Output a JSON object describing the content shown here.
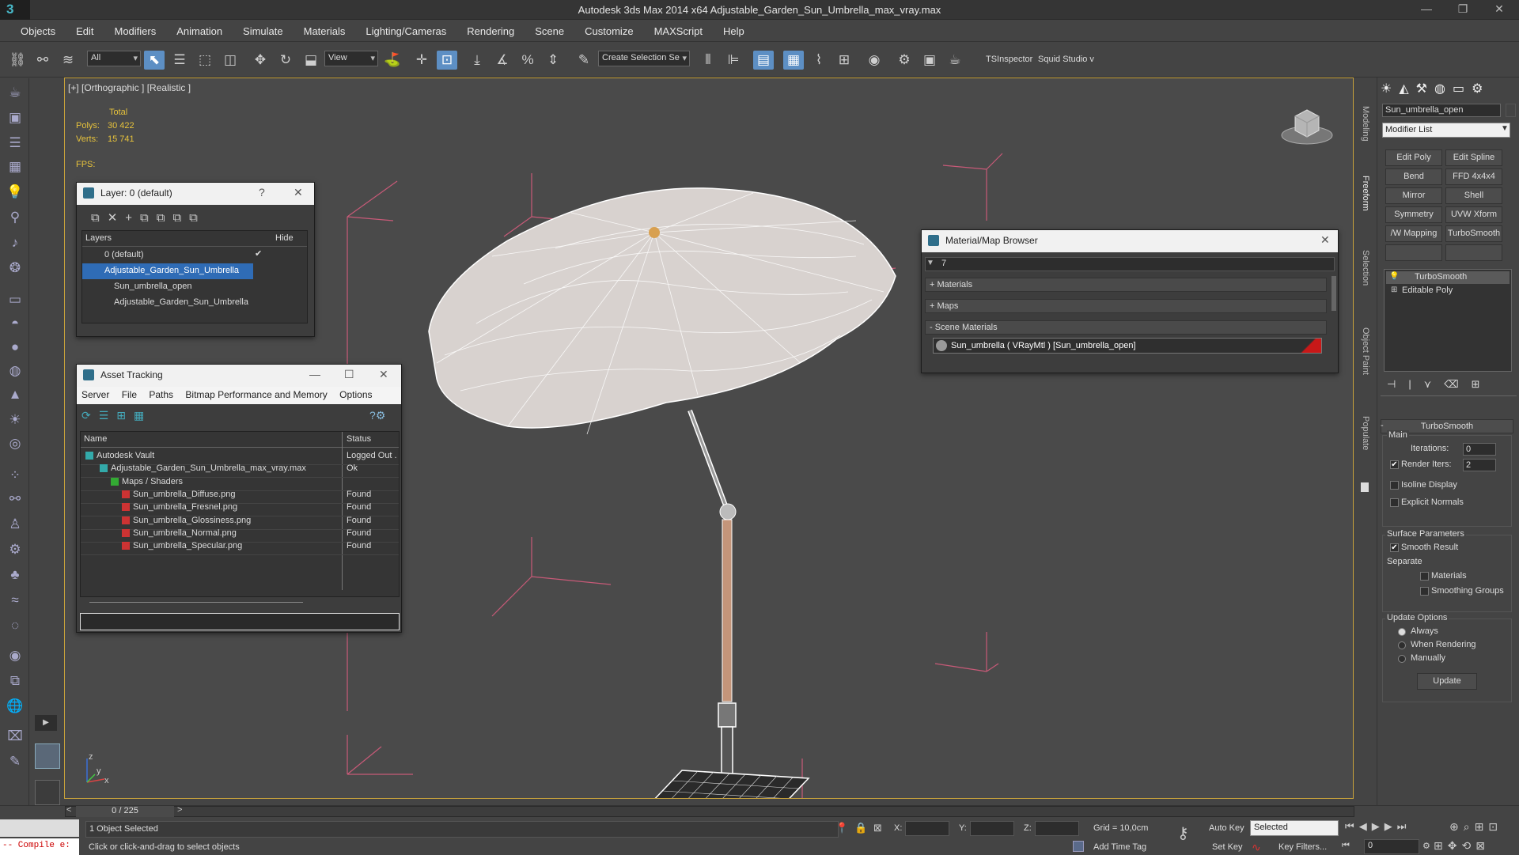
{
  "app": {
    "title": "Autodesk 3ds Max  2014 x64     Adjustable_Garden_Sun_Umbrella_max_vray.max",
    "logo": "3"
  },
  "window_controls": [
    "—",
    "❐",
    "✕"
  ],
  "menu": [
    "Objects",
    "Edit",
    "Modifiers",
    "Animation",
    "Simulate",
    "Materials",
    "Lighting/Cameras",
    "Rendering",
    "Scene",
    "Customize",
    "MAXScript",
    "Help"
  ],
  "toolbar": {
    "filter": "All",
    "refcoord": "View",
    "selection_set": "Create Selection Se",
    "tsinspector": "TSInspector",
    "squid": "Squid Studio v"
  },
  "viewport": {
    "label": "[+] [Orthographic ] [Realistic ]",
    "stats_header": "Total",
    "polys_label": "Polys:",
    "polys": "30 422",
    "verts_label": "Verts:",
    "verts": "15 741",
    "fps": "FPS:",
    "axis_x": "x",
    "axis_y": "y",
    "axis_z": "z"
  },
  "layer_dialog": {
    "title": "Layer: 0 (default)",
    "col_layers": "Layers",
    "col_hide": "Hide",
    "rows": [
      "0 (default)",
      "Adjustable_Garden_Sun_Umbrella",
      "Sun_umbrella_open",
      "Adjustable_Garden_Sun_Umbrella"
    ],
    "help": "?",
    "close": "✕"
  },
  "asset_tracking": {
    "title": "Asset Tracking",
    "menu": [
      "Server",
      "File",
      "Paths",
      "Bitmap Performance and Memory",
      "Options"
    ],
    "col_name": "Name",
    "col_status": "Status",
    "rows": [
      {
        "name": "Autodesk Vault",
        "status": "Logged Out ."
      },
      {
        "name": "Adjustable_Garden_Sun_Umbrella_max_vray.max",
        "status": "Ok"
      },
      {
        "name": "Maps / Shaders",
        "status": ""
      },
      {
        "name": "Sun_umbrella_Diffuse.png",
        "status": "Found"
      },
      {
        "name": "Sun_umbrella_Fresnel.png",
        "status": "Found"
      },
      {
        "name": "Sun_umbrella_Glossiness.png",
        "status": "Found"
      },
      {
        "name": "Sun_umbrella_Normal.png",
        "status": "Found"
      },
      {
        "name": "Sun_umbrella_Specular.png",
        "status": "Found"
      }
    ]
  },
  "material_browser": {
    "title": "Material/Map Browser",
    "search": "7",
    "groups": [
      "+ Materials",
      "+ Maps",
      "- Scene Materials"
    ],
    "scene_material": "Sun_umbrella  ( VRayMtl )  [Sun_umbrella_open]"
  },
  "command_panel": {
    "object_name": "Sun_umbrella_open",
    "modifier_list": "Modifier List",
    "buttons": [
      "Edit Poly",
      "Edit Spline",
      "Bend",
      "FFD 4x4x4",
      "Mirror",
      "Shell",
      "Symmetry",
      "UVW Xform",
      "/W Mapping Ac",
      "TurboSmooth"
    ],
    "stack": [
      "TurboSmooth",
      "Editable Poly"
    ],
    "rollout_title": "TurboSmooth",
    "main": "Main",
    "iterations_label": "Iterations:",
    "iterations": "0",
    "render_iters_label": "Render Iters:",
    "render_iters": "2",
    "render_iters_checked": true,
    "isoline": "Isoline Display",
    "explicit": "Explicit Normals",
    "surface": "Surface Parameters",
    "smooth_result": "Smooth Result",
    "separate": "Separate",
    "materials": "Materials",
    "smoothing_groups": "Smoothing Groups",
    "update_options": "Update Options",
    "always": "Always",
    "when_rendering": "When Rendering",
    "manually": "Manually",
    "update": "Update"
  },
  "side_tabs": [
    "Modeling",
    "Freeform",
    "Selection",
    "Object Paint",
    "Populate"
  ],
  "status": {
    "time": "0 / 225",
    "selected": "1 Object Selected",
    "prompt": "Click or click-and-drag to select objects",
    "script": "-- Compile e:",
    "x_label": "X:",
    "y_label": "Y:",
    "z_label": "Z:",
    "grid": "Grid = 10,0cm",
    "auto_key": "Auto Key",
    "set_key": "Set Key",
    "key_mode": "Selected",
    "key_filters": "Key Filters...",
    "add_time_tag": "Add Time Tag",
    "frame": "0"
  }
}
